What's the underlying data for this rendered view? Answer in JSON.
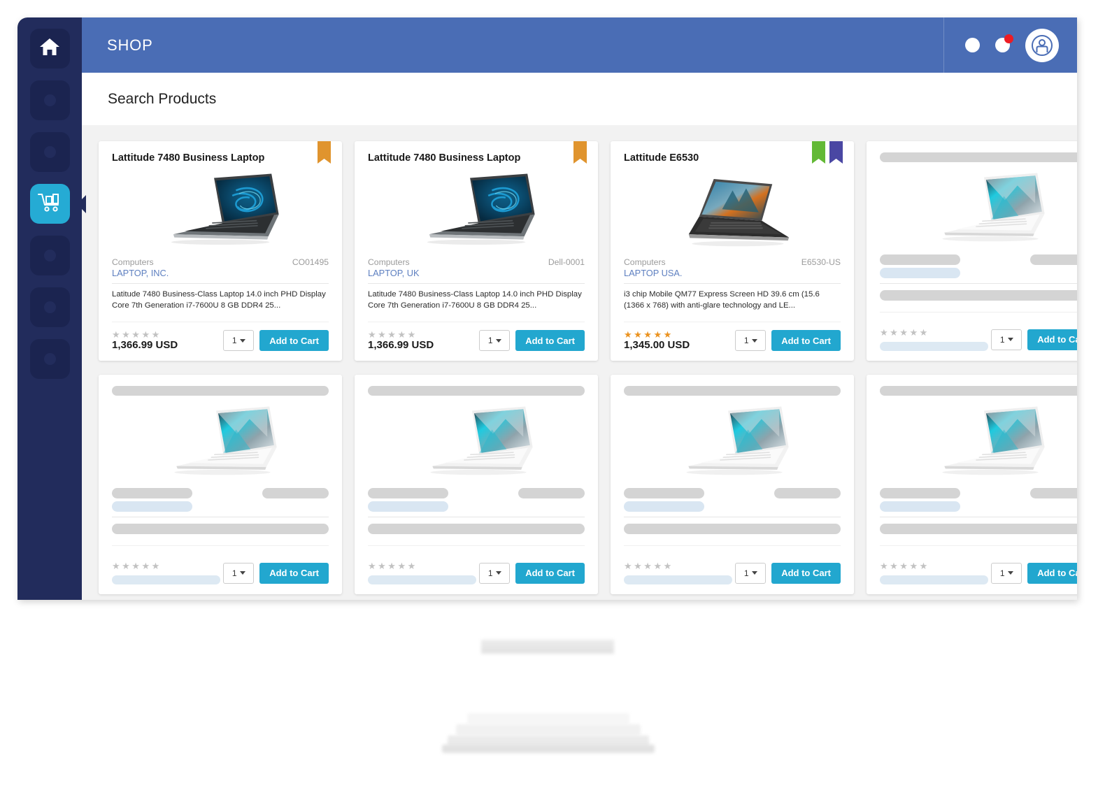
{
  "app": {
    "header": {
      "title": "SHOP",
      "icons": [
        {
          "name": "notification-circle-icon",
          "badge": false
        },
        {
          "name": "alerts-circle-icon",
          "badge": true,
          "badge_color": "#ed1c24"
        },
        {
          "name": "user-avatar-icon"
        }
      ]
    },
    "page_title": "Search Products"
  },
  "sidebar": {
    "items": [
      {
        "name": "home",
        "icon": "home-icon",
        "active": false,
        "placeholder": false
      },
      {
        "name": "nav-2",
        "icon": "dot-placeholder-icon",
        "active": false,
        "placeholder": true
      },
      {
        "name": "nav-3",
        "icon": "dot-placeholder-icon",
        "active": false,
        "placeholder": true
      },
      {
        "name": "shop-cart",
        "icon": "shopping-cart-icon",
        "active": true,
        "placeholder": false
      },
      {
        "name": "nav-5",
        "icon": "dot-placeholder-icon",
        "active": false,
        "placeholder": true
      },
      {
        "name": "nav-6",
        "icon": "dot-placeholder-icon",
        "active": false,
        "placeholder": true
      },
      {
        "name": "nav-7",
        "icon": "dot-placeholder-icon",
        "active": false,
        "placeholder": true
      }
    ],
    "active_color": "#25abd4",
    "background": "#222c5c"
  },
  "colors": {
    "header_blue": "#4a6db5",
    "accent_cyan": "#22a7cf",
    "vendor_link": "#5d7fc0",
    "star_filled": "#eb9320",
    "star_empty": "#c2c2c2",
    "ribbon_orange": "#e0942e",
    "ribbon_green": "#63b936",
    "ribbon_purple": "#4a47a3"
  },
  "labels": {
    "add_to_cart": "Add to Cart",
    "quantity": "1"
  },
  "products": [
    {
      "loaded": true,
      "title": "Lattitude 7480 Business Laptop",
      "ribbons": [
        "#e0942e"
      ],
      "category": "Computers",
      "sku": "CO01495",
      "vendor": "LAPTOP, INC.",
      "description": "Latitude 7480 Business-Class Laptop 14.0 inch PHD Display Core 7th Generation i7-7600U 8 GB DDR4 25...",
      "rating": 0,
      "price": "1,366.99 USD",
      "quantity": "1",
      "add_to_cart": "Add to Cart",
      "image": "dell-xps-dark"
    },
    {
      "loaded": true,
      "title": "Lattitude 7480 Business Laptop",
      "ribbons": [
        "#e0942e"
      ],
      "category": "Computers",
      "sku": "Dell-0001",
      "vendor": "LAPTOP, UK",
      "description": "Latitude 7480 Business-Class Laptop 14.0 inch PHD Display Core 7th Generation i7-7600U 8 GB DDR4 25...",
      "rating": 0,
      "price": "1,366.99 USD",
      "quantity": "1",
      "add_to_cart": "Add to Cart",
      "image": "dell-xps-dark"
    },
    {
      "loaded": true,
      "title": "Lattitude E6530",
      "ribbons": [
        "#63b936",
        "#4a47a3"
      ],
      "category": "Computers",
      "sku": "E6530-US",
      "vendor": "LAPTOP USA.",
      "description": "i3 chip Mobile QM77 Express Screen HD 39.6 cm (15.6 (1366 x 768) with anti-glare technology and LE...",
      "rating": 5,
      "price": "1,345.00 USD",
      "quantity": "1",
      "add_to_cart": "Add to Cart",
      "image": "dell-e6530"
    },
    {
      "loaded": false,
      "ribbons": [],
      "rating": 0,
      "quantity": "1",
      "add_to_cart": "Add to Cart",
      "image": "dell-xps-white"
    },
    {
      "loaded": false,
      "ribbons": [],
      "rating": 0,
      "quantity": "1",
      "add_to_cart": "Add to Cart",
      "image": "dell-xps-white"
    },
    {
      "loaded": false,
      "ribbons": [],
      "rating": 0,
      "quantity": "1",
      "add_to_cart": "Add to Cart",
      "image": "dell-xps-white"
    },
    {
      "loaded": false,
      "ribbons": [],
      "rating": 0,
      "quantity": "1",
      "add_to_cart": "Add to Cart",
      "image": "dell-xps-white"
    },
    {
      "loaded": false,
      "ribbons": [],
      "rating": 0,
      "quantity": "1",
      "add_to_cart": "Add to Cart",
      "image": "dell-xps-white"
    }
  ]
}
